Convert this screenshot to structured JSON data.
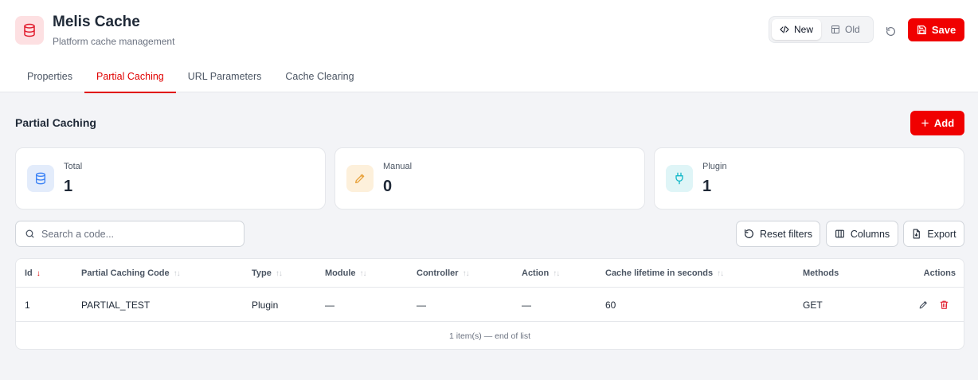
{
  "header": {
    "title": "Melis Cache",
    "subtitle": "Platform cache management",
    "switch": {
      "new_label": "New",
      "old_label": "Old",
      "active": "new"
    },
    "save_label": "Save"
  },
  "tabs": [
    {
      "label": "Properties",
      "active": false
    },
    {
      "label": "Partial Caching",
      "active": true
    },
    {
      "label": "URL Parameters",
      "active": false
    },
    {
      "label": "Cache Clearing",
      "active": false
    }
  ],
  "section": {
    "title": "Partial Caching",
    "add_label": "Add"
  },
  "stats": [
    {
      "label": "Total",
      "value": "1",
      "icon": "database-icon",
      "color": "#3b82f6",
      "bg": "#e3ecfb"
    },
    {
      "label": "Manual",
      "value": "0",
      "icon": "pencil-icon",
      "color": "#e8a23b",
      "bg": "#fdf0db"
    },
    {
      "label": "Plugin",
      "value": "1",
      "icon": "plug-icon",
      "color": "#14b8c8",
      "bg": "#dff5f7"
    }
  ],
  "toolbar": {
    "search_placeholder": "Search a code...",
    "reset_filters_label": "Reset filters",
    "columns_label": "Columns",
    "export_label": "Export"
  },
  "table": {
    "columns": [
      {
        "label": "Id",
        "sort": "desc"
      },
      {
        "label": "Partial Caching Code",
        "sort": "none"
      },
      {
        "label": "Type",
        "sort": "none"
      },
      {
        "label": "Module",
        "sort": "none"
      },
      {
        "label": "Controller",
        "sort": "none"
      },
      {
        "label": "Action",
        "sort": "none"
      },
      {
        "label": "Cache lifetime in seconds",
        "sort": "none"
      },
      {
        "label": "Methods",
        "sort": ""
      },
      {
        "label": "Actions",
        "sort": ""
      }
    ],
    "rows": [
      {
        "id": "1",
        "code": "PARTIAL_TEST",
        "type": "Plugin",
        "module": "—",
        "controller": "—",
        "action": "—",
        "lifetime": "60",
        "methods": "GET"
      }
    ],
    "footer": "1 item(s) — end of list"
  },
  "colors": {
    "accent": "#f00000",
    "accent_text": "#e00000",
    "background": "#f3f4f7"
  }
}
